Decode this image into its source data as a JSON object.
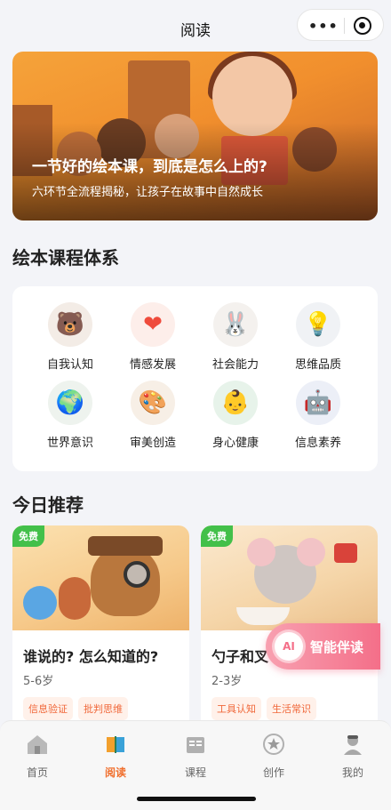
{
  "nav": {
    "title": "阅读"
  },
  "banner": {
    "title": "一节好的绘本课，到底是怎么上的?",
    "subtitle": "六环节全流程揭秘，让孩子在故事中自然成长"
  },
  "curriculum": {
    "title": "绘本课程体系",
    "items": [
      {
        "label": "自我认知",
        "icon": "bear-family-icon"
      },
      {
        "label": "情感发展",
        "icon": "heart-icon"
      },
      {
        "label": "社会能力",
        "icon": "friends-icon"
      },
      {
        "label": "思维品质",
        "icon": "lightbulb-icon"
      },
      {
        "label": "世界意识",
        "icon": "globe-icon"
      },
      {
        "label": "审美创造",
        "icon": "palette-icon"
      },
      {
        "label": "身心健康",
        "icon": "baby-icon"
      },
      {
        "label": "信息素养",
        "icon": "robot-icon"
      }
    ]
  },
  "today": {
    "title": "今日推荐",
    "cards": [
      {
        "badge": "免费",
        "title": "谁说的? 怎么知道的?",
        "age": "5-6岁",
        "tags": [
          "信息验证",
          "批判思维"
        ]
      },
      {
        "badge": "免费",
        "title": "勺子和叉",
        "age": "2-3岁",
        "tags": [
          "工具认知",
          "生活常识"
        ]
      }
    ]
  },
  "ai": {
    "badge": "AI",
    "label": "智能伴读"
  },
  "tabs": [
    {
      "label": "首页",
      "icon": "home-icon"
    },
    {
      "label": "阅读",
      "icon": "book-icon",
      "active": true
    },
    {
      "label": "课程",
      "icon": "course-icon"
    },
    {
      "label": "创作",
      "icon": "star-icon"
    },
    {
      "label": "我的",
      "icon": "profile-icon"
    }
  ],
  "colors": {
    "accent": "#f06f2d",
    "free": "#43c04a",
    "ai": "#f46f89"
  }
}
